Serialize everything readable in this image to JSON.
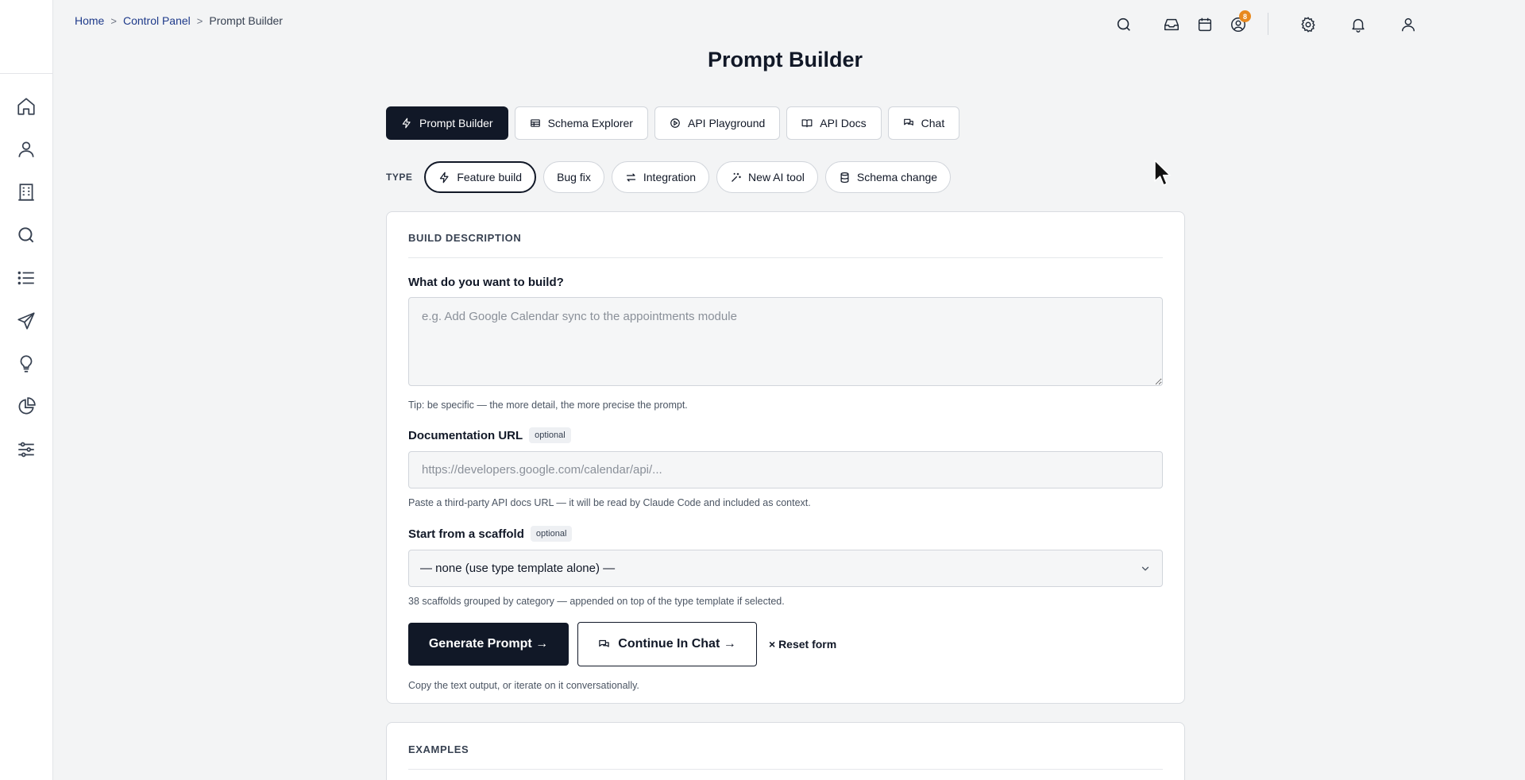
{
  "breadcrumb": {
    "home": "Home",
    "control_panel": "Control Panel",
    "current": "Prompt Builder",
    "separator": ">"
  },
  "header": {
    "notification_badge": "8",
    "icons": [
      "search-icon",
      "inbox-icon",
      "calendar-icon",
      "user-badge-icon",
      "gear-icon",
      "bell-icon",
      "user-icon"
    ]
  },
  "sidebar": {
    "icons": [
      "home-icon",
      "user-icon",
      "building-icon",
      "search-icon",
      "list-icon",
      "send-icon",
      "lightbulb-icon",
      "pie-chart-icon",
      "sliders-icon"
    ]
  },
  "page": {
    "title": "Prompt Builder"
  },
  "tabs": [
    {
      "label": "Prompt Builder",
      "icon": "bolt-icon",
      "active": true
    },
    {
      "label": "Schema Explorer",
      "icon": "table-icon"
    },
    {
      "label": "API Playground",
      "icon": "play-circle-icon"
    },
    {
      "label": "API Docs",
      "icon": "book-icon"
    },
    {
      "label": "Chat",
      "icon": "chat-icon"
    }
  ],
  "type": {
    "label": "TYPE",
    "chips": [
      {
        "label": "Feature build",
        "icon": "bolt-icon",
        "active": true
      },
      {
        "label": "Bug fix"
      },
      {
        "label": "Integration",
        "icon": "swap-icon"
      },
      {
        "label": "New AI tool",
        "icon": "sparkle-icon"
      },
      {
        "label": "Schema change",
        "icon": "database-icon"
      }
    ]
  },
  "build": {
    "heading": "BUILD DESCRIPTION",
    "what_label": "What do you want to build?",
    "what_placeholder": "e.g. Add Google Calendar sync to the appointments module",
    "what_hint": "Tip: be specific — the more detail, the more precise the prompt.",
    "doc_label": "Documentation URL",
    "optional": "optional",
    "doc_placeholder": "https://developers.google.com/calendar/api/...",
    "doc_hint": "Paste a third-party API docs URL — it will be read by Claude Code and included as context.",
    "scaffold_label": "Start from a scaffold",
    "scaffold_value": "— none (use type template alone) —",
    "scaffold_hint": "38 scaffolds grouped by category — appended on top of the type template if selected.",
    "generate": "Generate Prompt →",
    "continue": "Continue In Chat →",
    "reset": "× Reset form",
    "actions_hint": "Copy the text output, or iterate on it conversationally."
  },
  "examples": {
    "heading": "EXAMPLES"
  },
  "colors": {
    "primary": "#111827",
    "badge": "#e8891e",
    "link": "#1e3a8a",
    "background": "#f3f4f5"
  }
}
